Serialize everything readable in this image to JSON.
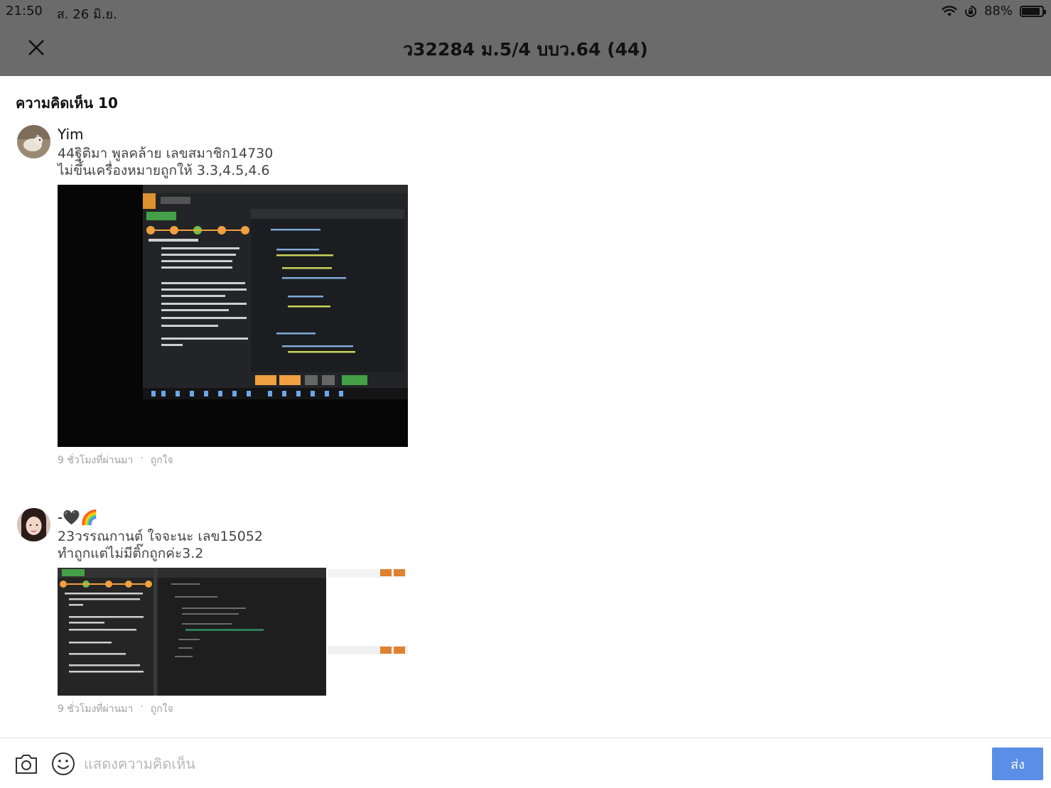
{
  "status_bar": {
    "time": "21:50",
    "date": "ส. 26 มิ.ย.",
    "battery": "88%",
    "battery_level": 0.88
  },
  "header": {
    "title": "ว32284 ม.5/4 บบว.64 (44)"
  },
  "comments_section": {
    "count_label": "ความคิดเห็น 10",
    "comments": [
      {
        "author": "Yim",
        "text": "44ฐิติมา พูลคล้าย เลขสมาชิก14730\nไม่ขึ้นเครื่องหมายถูกให้ 3.3,4.5,4.6",
        "time": "9 ชั่วโมงที่ผ่านมา",
        "separator": "·",
        "like_label": "ถูกใจ"
      },
      {
        "author": "-🖤🌈",
        "text": "23วรรณกานต์ ใจจะนะ เลข15052\nทำถูกแต่ไม่มีติ๊กถูกค่ะ3.2",
        "time": "9 ชั่วโมงที่ผ่านมา",
        "separator": "·",
        "like_label": "ถูกใจ"
      }
    ]
  },
  "composer": {
    "placeholder": "แสดงความคิดเห็น",
    "send_label": "ส่ง"
  },
  "colors": {
    "header_bg": "#6b6b6b",
    "send_button": "#5b8ee6",
    "muted_text": "#a0a0a0"
  },
  "icons": [
    "close-icon",
    "wifi-icon",
    "rotation-lock-icon",
    "battery-icon",
    "camera-icon",
    "emoji-icon"
  ]
}
